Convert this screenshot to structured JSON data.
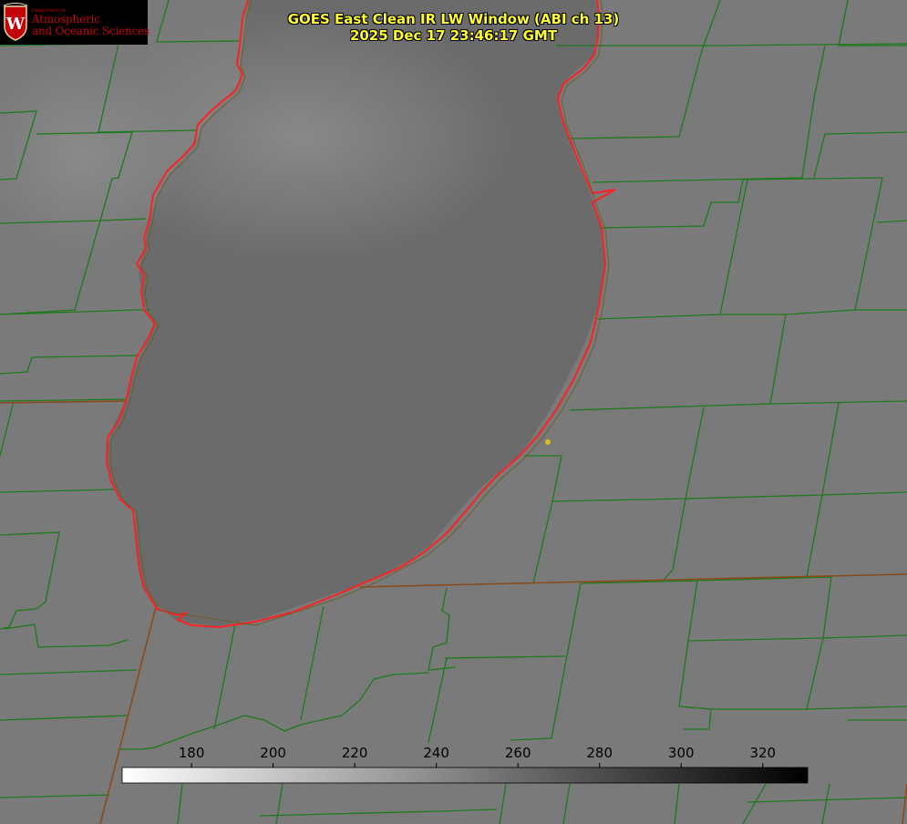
{
  "logo": {
    "department": "Department of",
    "line1": "Atmospheric",
    "line2": "and Oceanic Sciences",
    "crest_letter": "W"
  },
  "title": {
    "line1": "GOES East Clean IR LW Window (ABI ch 13)",
    "line2": "2025 Dec 17 23:46:17 GMT"
  },
  "colorbar": {
    "ticks": [
      "180",
      "200",
      "220",
      "240",
      "260",
      "280",
      "300",
      "320"
    ],
    "min": 163,
    "max": 331,
    "tick_values": [
      180,
      200,
      220,
      240,
      260,
      280,
      300,
      320
    ]
  },
  "colors": {
    "land": "#7a7a7a",
    "lake": "#6a6a6a",
    "cloud": "#8a8a8a",
    "county_lines": "#1a7a1a",
    "state_lines": "#8a4a1a",
    "shoreline": "#ff2020",
    "marker": "#d8c020",
    "title_text": "#ffff33",
    "logo_red": "#c5050c"
  }
}
